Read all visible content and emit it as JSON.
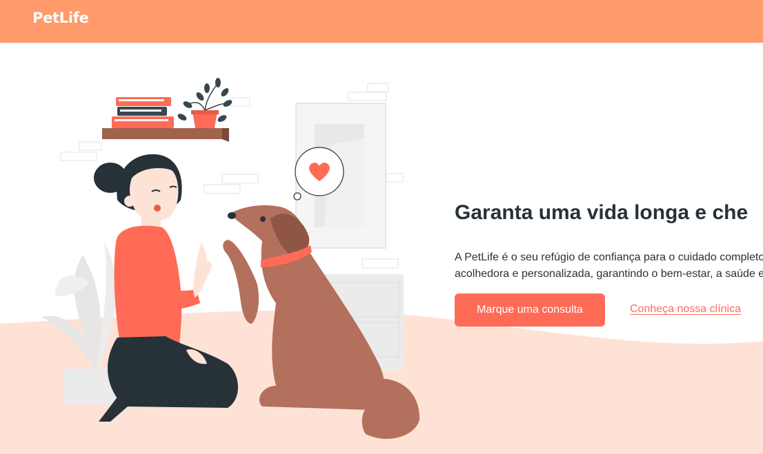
{
  "header": {
    "brand": "PetLife"
  },
  "hero": {
    "title": "Garanta uma vida longa e che",
    "text_line1": "A PetLife é o seu refúgio de confiança para o cuidado completo",
    "text_line2": "acolhedora e personalizada, garantindo o bem-estar, a saúde e",
    "primary_cta": "Marque uma consulta",
    "secondary_link": "Conheça nossa clínica"
  },
  "colors": {
    "header_bg": "#ff9a6b",
    "accent": "#ff6b57",
    "floor": "#ffe2d6",
    "dark": "#263238"
  },
  "illustration": {
    "subject": "woman-giving-high-five-to-dog",
    "icons": [
      "heart-icon",
      "plant-icon",
      "books-icon"
    ]
  }
}
